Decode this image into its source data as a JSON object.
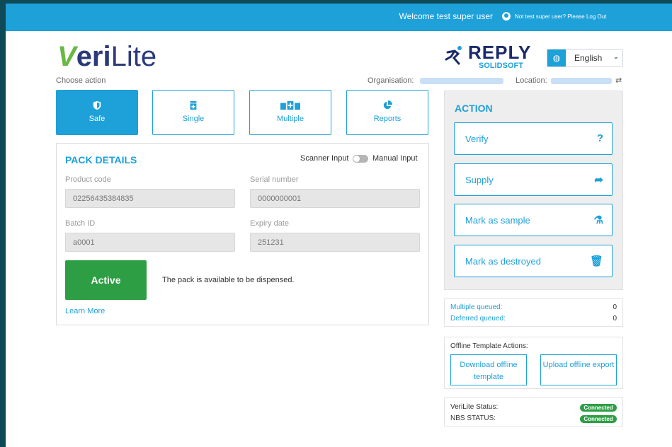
{
  "topbar": {
    "welcome": "Welcome  test super user",
    "logout": "Not test super user? Please Log Out"
  },
  "brand": {
    "logo_v": "V",
    "logo_eri": "eri",
    "logo_lite": "Lite",
    "partner_name": "REPLY",
    "partner_sub": "SOLIDSOFT"
  },
  "language": {
    "selected": "English"
  },
  "context": {
    "choose_action": "Choose action",
    "organisation_label": "Organisation:",
    "location_label": "Location:",
    "swap_glyph": "⇄"
  },
  "tiles": [
    {
      "label": "Safe",
      "icon": "shield-icon",
      "active": true
    },
    {
      "label": "Single",
      "icon": "single-pack-icon",
      "active": false
    },
    {
      "label": "Multiple",
      "icon": "multiple-packs-icon",
      "active": false
    },
    {
      "label": "Reports",
      "icon": "pie-chart-icon",
      "active": false
    }
  ],
  "pack": {
    "title": "PACK DETAILS",
    "scanner_label": "Scanner Input",
    "manual_label": "Manual Input",
    "product_code_label": "Product code",
    "product_code": "02256435384835",
    "serial_number_label": "Serial number",
    "serial_number": "0000000001",
    "batch_id_label": "Batch ID",
    "batch_id": "a0001",
    "expiry_date_label": "Expiry date",
    "expiry_date": "251231",
    "status": "Active",
    "status_message": "The pack is available to be dispensed.",
    "learn_more": "Learn More"
  },
  "action": {
    "title": "ACTION",
    "buttons": [
      {
        "label": "Verify",
        "icon": "question-icon",
        "glyph": "?"
      },
      {
        "label": "Supply",
        "icon": "share-arrow-icon",
        "glyph": "➦"
      },
      {
        "label": "Mark as sample",
        "icon": "flask-icon",
        "glyph": "⚗"
      },
      {
        "label": "Mark as destroyed",
        "icon": "trash-icon",
        "glyph": "🗑"
      }
    ]
  },
  "queue": {
    "multiple_label": "Multiple queued:",
    "multiple_value": "0",
    "deferred_label": "Deferred queued:",
    "deferred_value": "0"
  },
  "offline": {
    "title": "Offline Template Actions:",
    "download": "Download offline template",
    "upload": "Upload offline export"
  },
  "status": {
    "verilite_label": "VeriLite Status:",
    "verilite_value": "Connected",
    "nbs_label": "NBS STATUS:",
    "nbs_value": "Connected"
  },
  "colors": {
    "primary": "#1ea0d9",
    "success": "#2e9e45",
    "logo_green": "#6ab745",
    "navy": "#2a3a7a",
    "frame": "#0f4a57"
  }
}
